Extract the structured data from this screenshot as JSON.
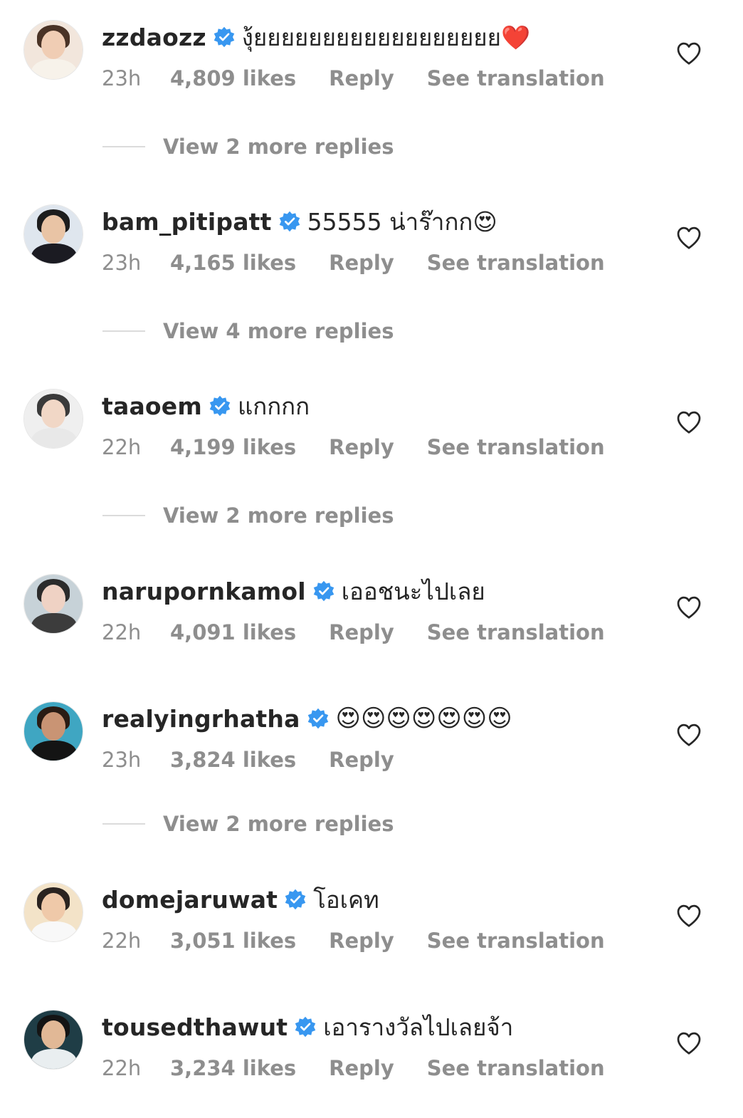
{
  "comments": [
    {
      "username": "zzdaozz",
      "text": "งุ้ยยยยยยยยยยยยยยยยยย❤️",
      "time": "23h",
      "likes": "4,809 likes",
      "reply": "Reply",
      "translation": "See translation",
      "more_replies": "View 2 more replies",
      "avatar_colors": {
        "bg": "#f2e6dc",
        "hair": "#4a3326",
        "skin": "#f0cdb4",
        "torso": "#f7f2ea"
      }
    },
    {
      "username": "bam_pitipatt",
      "text": "55555 น่าร๊ากก😍",
      "time": "23h",
      "likes": "4,165 likes",
      "reply": "Reply",
      "translation": "See translation",
      "more_replies": "View 4 more replies",
      "avatar_colors": {
        "bg": "#dfe6ee",
        "hair": "#1d1d1d",
        "skin": "#e9c4a5",
        "torso": "#1b1b22"
      }
    },
    {
      "username": "taaoem",
      "text": "แกกกก",
      "time": "22h",
      "likes": "4,199 likes",
      "reply": "Reply",
      "translation": "See translation",
      "more_replies": "View 2 more replies",
      "avatar_colors": {
        "bg": "#efefef",
        "hair": "#3a3a3a",
        "skin": "#f1d7c6",
        "torso": "#e8e8e8"
      }
    },
    {
      "username": "narupornkamol",
      "text": "เออชนะไปเลย",
      "time": "22h",
      "likes": "4,091 likes",
      "reply": "Reply",
      "translation": "See translation",
      "more_replies": "",
      "avatar_colors": {
        "bg": "#c7d2d8",
        "hair": "#2b2b2b",
        "skin": "#efd2c4",
        "torso": "#3c3c3c"
      }
    },
    {
      "username": "realyingrhatha",
      "text": "😍😍😍😍😍😍😍",
      "time": "23h",
      "likes": "3,824 likes",
      "reply": "Reply",
      "translation": "",
      "more_replies": "View 2 more replies",
      "avatar_colors": {
        "bg": "#3fa6c2",
        "hair": "#2a1c14",
        "skin": "#c99474",
        "torso": "#141414"
      }
    },
    {
      "username": "domejaruwat",
      "text": "โอเคท",
      "time": "22h",
      "likes": "3,051 likes",
      "reply": "Reply",
      "translation": "See translation",
      "more_replies": "",
      "avatar_colors": {
        "bg": "#f3e3c8",
        "hair": "#2a2320",
        "skin": "#efc9a9",
        "torso": "#f8f8f8"
      }
    },
    {
      "username": "tousedthawut",
      "text": "เอารางวัลไปเลยจ้า",
      "time": "22h",
      "likes": "3,234 likes",
      "reply": "Reply",
      "translation": "See translation",
      "more_replies": "",
      "avatar_colors": {
        "bg": "#1f3d46",
        "hair": "#141414",
        "skin": "#e1b896",
        "torso": "#e9eef0"
      }
    }
  ],
  "colors": {
    "verified": "#3897f0",
    "heart_stroke": "#262626",
    "meta": "#8e8e8e"
  },
  "icons": {
    "verified": "verified-badge-icon",
    "heart": "heart-outline-icon"
  }
}
